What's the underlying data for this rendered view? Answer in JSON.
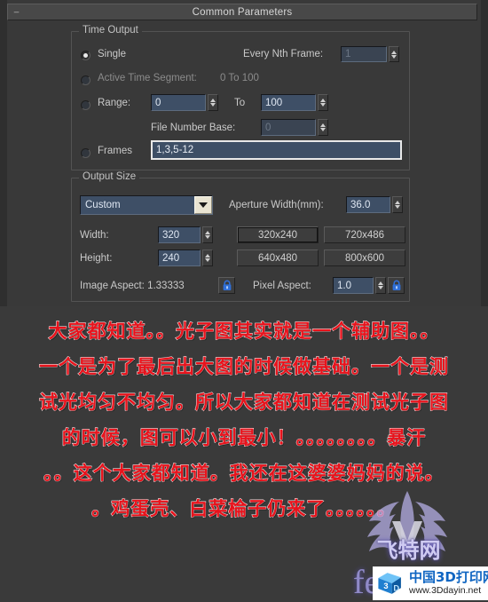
{
  "window": {
    "title": "Common Parameters",
    "collapse_glyph": "–"
  },
  "time_output": {
    "group_label": "Time Output",
    "single_label": "Single",
    "every_nth_frame_label": "Every Nth Frame:",
    "every_nth_frame_value": "1",
    "active_time_segment_label": "Active Time Segment:",
    "active_time_segment_value": "0 To 100",
    "range_label": "Range:",
    "range_from": "0",
    "range_to_label": "To",
    "range_to": "100",
    "file_number_base_label": "File Number Base:",
    "file_number_base_value": "0",
    "frames_label": "Frames",
    "frames_value": "1,3,5-12"
  },
  "output_size": {
    "group_label": "Output Size",
    "preset_select_value": "Custom",
    "aperture_label": "Aperture Width(mm):",
    "aperture_value": "36.0",
    "width_label": "Width:",
    "width_value": "320",
    "height_label": "Height:",
    "height_value": "240",
    "presets": [
      "320x240",
      "720x486",
      "640x480",
      "800x600"
    ],
    "image_aspect_label": "Image Aspect: 1.33333",
    "pixel_aspect_label": "Pixel Aspect:",
    "pixel_aspect_value": "1.0"
  },
  "caption": {
    "lines": [
      "大家都知道。。光子图其实就是一个辅助图。。",
      "一个是为了最后出大图的时候做基础。一个是测",
      "试光均匀不均匀。所以大家都知道在测试光子图",
      "的时候，图可以小到最小！。。。。。。。。暴汗",
      "。。这个大家都知道。我还在这婆婆妈妈的说。",
      "。鸡蛋壳、白菜棆子仍来了。。。。。。"
    ],
    "text_color": "#e8131c",
    "outline_color": "#ffffff"
  },
  "watermark": {
    "site_name_cn": "飞特网",
    "site_name_en": "fe",
    "badge_title": "中国3D打印网",
    "badge_url": "www.3Ddayin.net",
    "badge_logo_text": "3D"
  }
}
